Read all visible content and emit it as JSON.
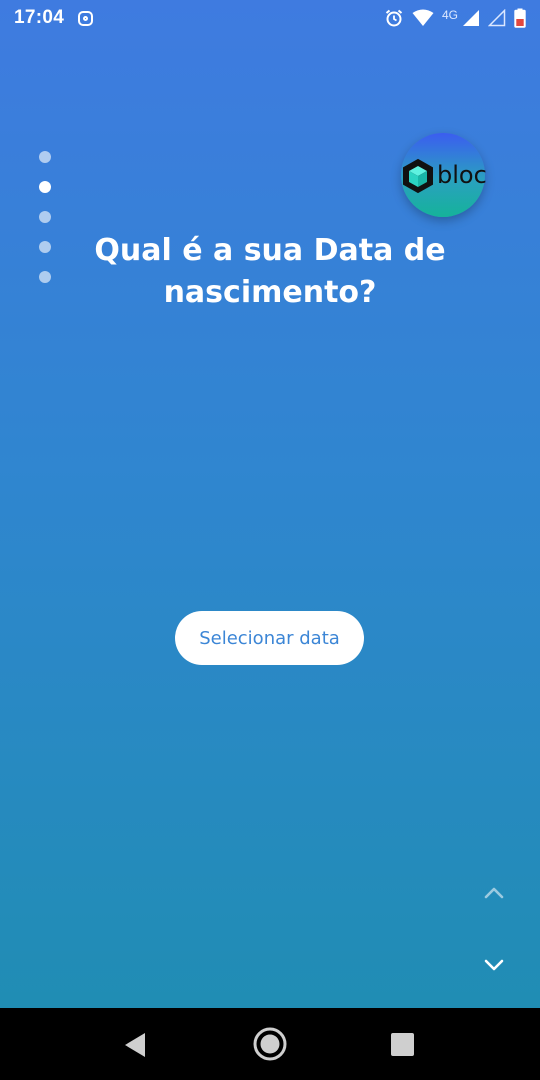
{
  "status_bar": {
    "time": "17:04",
    "network_label": "4G",
    "icons": [
      "instagram-icon",
      "alarm-icon",
      "wifi-icon",
      "signal-icon",
      "signal-empty-icon",
      "battery-icon"
    ]
  },
  "logo": {
    "text": "bloc"
  },
  "pager": {
    "total": 5,
    "active_index": 1
  },
  "question": {
    "line1": "Qual é a sua Data de",
    "line2": "nascimento?"
  },
  "actions": {
    "select_date_label": "Selecionar data"
  },
  "colors": {
    "background_top": "#3f7be0",
    "background_bottom": "#1e8eb0",
    "button_text": "#3c86d6"
  }
}
